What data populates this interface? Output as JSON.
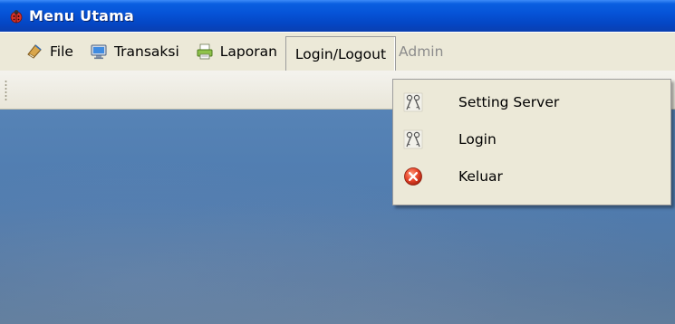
{
  "window": {
    "title": "Menu Utama"
  },
  "menubar": {
    "items": [
      {
        "label": "File",
        "icon": "book-icon"
      },
      {
        "label": "Transaksi",
        "icon": "monitor-icon"
      },
      {
        "label": "Laporan",
        "icon": "printer-icon"
      },
      {
        "label": "Login/Logout",
        "icon": ""
      }
    ],
    "user_label": "Admin",
    "open_menu": "Login/Logout"
  },
  "dropdown": {
    "items": [
      {
        "label": "Setting Server",
        "icon": "keys-icon"
      },
      {
        "label": "Login",
        "icon": "keys-icon"
      },
      {
        "label": "Keluar",
        "icon": "close-icon"
      }
    ]
  },
  "colors": {
    "titlebar": "#0654d8",
    "menubar": "#ece9d8",
    "desktop": "#4f7bae",
    "close_icon": "#e8452a"
  }
}
